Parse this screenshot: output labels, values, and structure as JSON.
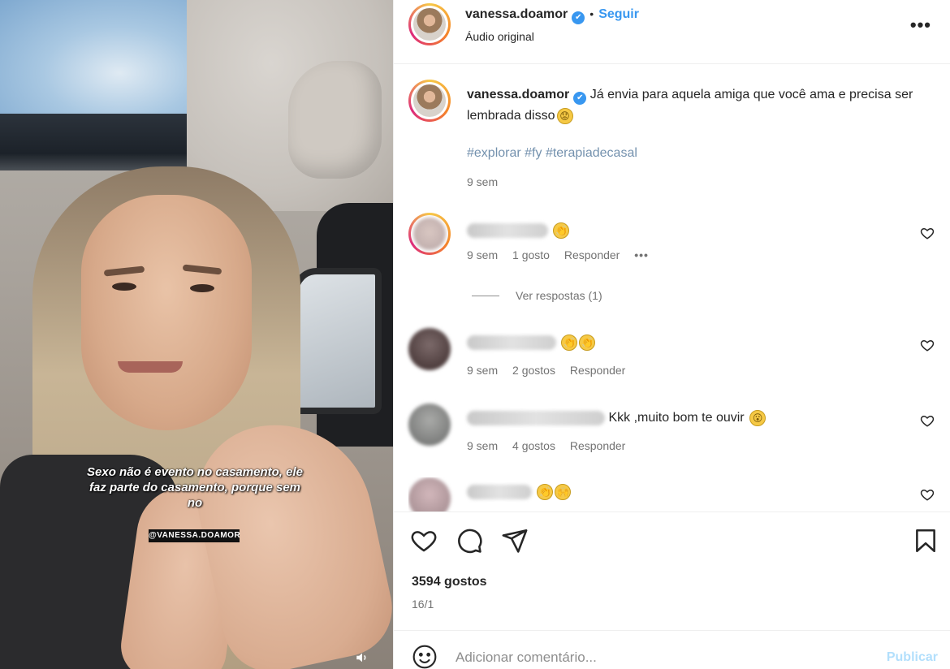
{
  "video": {
    "caption_overlay": "Sexo não é evento no casamento, ele faz parte do casamento, porque sem no",
    "handle_overlay": "@VANESSA.DOAMOR",
    "mute_icon": "speaker-icon"
  },
  "post_header": {
    "username": "vanessa.doamor",
    "follow_label": "Seguir",
    "separator": "•",
    "audio_label": "Áudio original",
    "more_icon": "more-horizontal-icon",
    "more_label": "•••"
  },
  "caption": {
    "username": "vanessa.doamor",
    "text": "Já envia para aquela amiga que você ama e precisa ser lembrada disso",
    "emoji": "😟",
    "hashtags": "#explorar #fy #terapiadecasal",
    "time": "9 sem"
  },
  "comments": [
    {
      "text": "",
      "emoji": [
        "👏"
      ],
      "time": "9 sem",
      "likes": "1 gosto",
      "reply": "Responder",
      "more": "•••"
    },
    {
      "text": "",
      "emoji": [
        "👏",
        "👏"
      ],
      "time": "9 sem",
      "likes": "2 gostos",
      "reply": "Responder"
    },
    {
      "text": "Kkk ,muito bom te ouvir",
      "emoji": [
        "😮"
      ],
      "time": "9 sem",
      "likes": "4 gostos",
      "reply": "Responder"
    },
    {
      "text": "",
      "emoji": [
        "👏",
        "🙌"
      ],
      "time": "",
      "likes": "",
      "reply": ""
    }
  ],
  "view_replies": "Ver respostas (1)",
  "actions": {
    "like_icon": "heart-icon",
    "comment_icon": "comment-icon",
    "share_icon": "send-icon",
    "save_icon": "bookmark-icon"
  },
  "likes_count": "3594 gostos",
  "date": "16/1",
  "add_comment": {
    "placeholder": "Adicionar comentário...",
    "publish_label": "Publicar",
    "emoji_icon": "smiley-icon"
  },
  "colors": {
    "link_blue": "#3897f0",
    "verified_blue": "#3897f0",
    "publish_disabled": "#b2dffc",
    "muted_text": "#737373"
  }
}
